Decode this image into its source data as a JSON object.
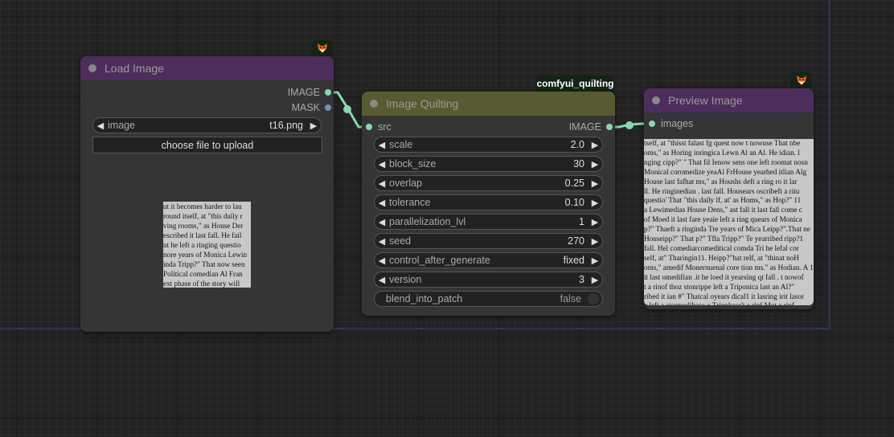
{
  "canvas": {
    "background": "#222222",
    "link_color": "#88d8b0"
  },
  "nodes": {
    "load_image": {
      "title": "Load Image",
      "badge_icon": "fox-icon",
      "title_color": "#4d2d5c",
      "outputs": [
        {
          "label": "IMAGE",
          "color": "#88d8b0"
        },
        {
          "label": "MASK",
          "color": "#6a93b8"
        }
      ],
      "widgets": {
        "image": {
          "label": "image",
          "value": "t16.png"
        }
      },
      "upload_label": "choose file to upload",
      "preview_text": [
        "ut it becomes harder to lau",
        "round itself, at \"this daily r",
        "ving rooms,\" as House Der",
        "escribed it last fall. He fail",
        "ut he left a ringing questio",
        "nore years of Monica Lewin",
        "inda Tripp?\" That now seen",
        "Political comedian Al Fran",
        "ext phase of the story will"
      ]
    },
    "image_quilting": {
      "title": "Image Quilting",
      "badge_label": "comfyui_quilting",
      "title_color": "#585a31",
      "inputs": [
        {
          "label": "src",
          "color": "#88d8b0"
        }
      ],
      "outputs": [
        {
          "label": "IMAGE",
          "color": "#88d8b0"
        }
      ],
      "widgets": [
        {
          "label": "scale",
          "value": "2.0"
        },
        {
          "label": "block_size",
          "value": "30"
        },
        {
          "label": "overlap",
          "value": "0.25"
        },
        {
          "label": "tolerance",
          "value": "0.10"
        },
        {
          "label": "parallelization_lvl",
          "value": "1"
        },
        {
          "label": "seed",
          "value": "270"
        },
        {
          "label": "control_after_generate",
          "value": "fixed"
        },
        {
          "label": "version",
          "value": "3"
        }
      ],
      "toggle": {
        "label": "blend_into_patch",
        "value": "false"
      }
    },
    "preview_image": {
      "title": "Preview Image",
      "badge_icon": "fox-icon",
      "title_color": "#4d2d5c",
      "inputs": [
        {
          "label": "images",
          "color": "#88d8b0"
        }
      ],
      "preview_text": [
        "tself, at \"thisst falast fg quest now t nowuse That nbe",
        "oms,\" as Horing inringica Lewn Al an Al. He idian. l",
        "nging cipp?\" \" That fil Ienow sens one left roomat nosn",
        "Monical coromedize yeaAl FrHouse yearhed itlian Alg",
        "House last fafhat ms,\" as Houshs deft a ring ro it lar",
        "ll. He ringinedian . last fall. Housears oscribeft a ritu",
        "questio' That \"this daily lf, at' as Homs,\" as Hop?\" 11",
        "a Lewimedias House Dens,\" ast fall it last fall come c",
        "of Moed it last fare yeaie left a ring quears of Monica",
        "p?\" Thaeft a ringinda Tre years of Mica Leipp?\".That ne",
        "Houseipp?\" That p?\" Tfla Tripp?\" Te yearribed ripp?1",
        "fall. Hel comediarcomeditical comda Tri he lefal cor",
        "self, at\" Tharingin11. Heipp?\"hat relf, at \"thinat noH",
        "oms,\" amedif Monernuenal core tion ms.\" as Hodian. A 1",
        "it last omedifian .it he loed it yearsing qt fall . t nowof",
        "t a rinof thoz stonrippe left a Triponica last an Al?\"",
        "ribed it ian #\" Thatcal oyears dical1 it lasring irit lasor",
        "e left a stormedibase o Tripphase't a rinf Mot a rinf"
      ]
    }
  }
}
